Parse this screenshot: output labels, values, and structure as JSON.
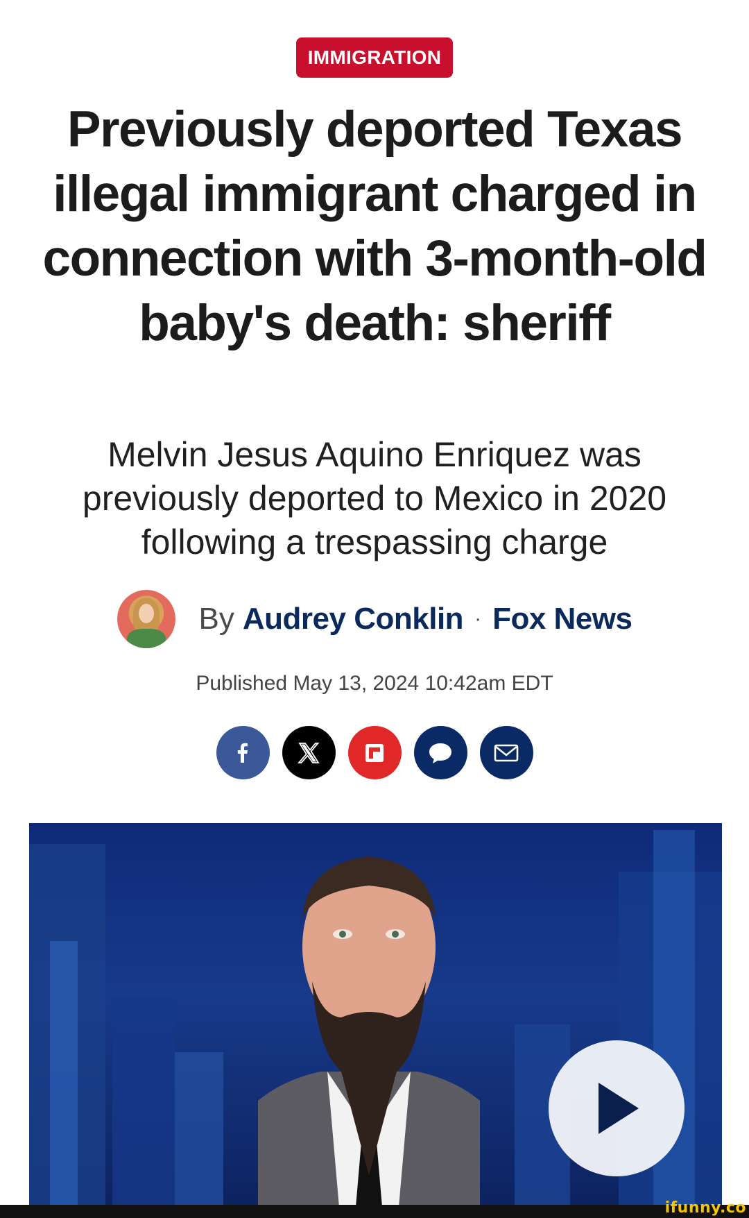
{
  "article": {
    "category": "IMMIGRATION",
    "headline": "Previously deported Texas illegal immigrant charged in connection with 3-month-old baby's death: sheriff",
    "subheadline": "Melvin Jesus Aquino Enriquez was previously deported to Mexico in 2020 following a trespassing charge",
    "byline": {
      "by_label": "By",
      "author": "Audrey Conklin",
      "separator": "·",
      "outlet": "Fox News"
    },
    "published": "Published May 13, 2024 10:42am EDT"
  },
  "share": {
    "buttons": [
      {
        "name": "facebook",
        "icon": "facebook-icon",
        "color": "#3b5998"
      },
      {
        "name": "x",
        "icon": "x-icon",
        "color": "#000000"
      },
      {
        "name": "flipboard",
        "icon": "flipboard-icon",
        "color": "#e12828"
      },
      {
        "name": "comments",
        "icon": "comment-icon",
        "color": "#0a2a66"
      },
      {
        "name": "email",
        "icon": "email-icon",
        "color": "#0a2a66"
      }
    ]
  },
  "video": {
    "play_icon": "play-icon"
  },
  "watermark": {
    "text": "ifunny.co"
  },
  "colors": {
    "category_red": "#c8102e",
    "link_navy": "#0b2a5b"
  }
}
